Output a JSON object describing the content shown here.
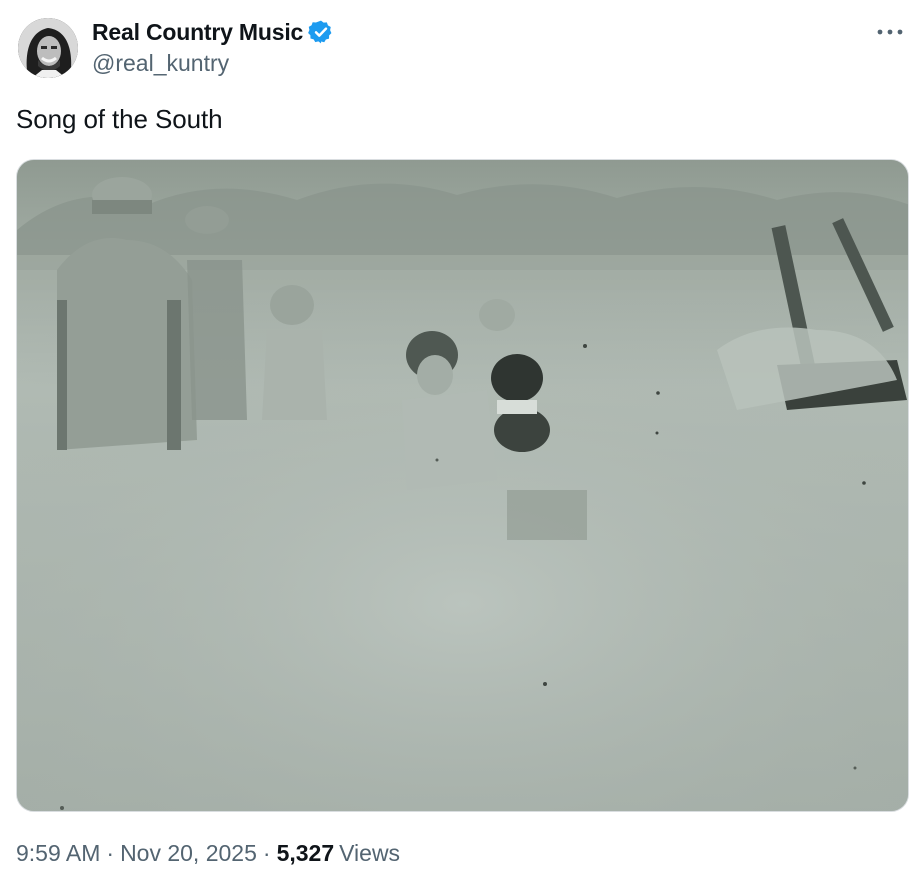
{
  "author": {
    "display_name": "Real Country Music",
    "handle": "@real_kuntry",
    "verified": true,
    "verified_color": "#1d9bf0"
  },
  "tweet": {
    "text": "Song of the South",
    "media_icon": "video-thumbnail"
  },
  "meta": {
    "time": "9:59 AM",
    "separator": "·",
    "date": "Nov 20, 2025",
    "views_count": "5,327",
    "views_label": "Views"
  },
  "menu": {
    "icon": "more-icon"
  },
  "colors": {
    "text_primary": "#0f1419",
    "text_secondary": "#536471"
  }
}
